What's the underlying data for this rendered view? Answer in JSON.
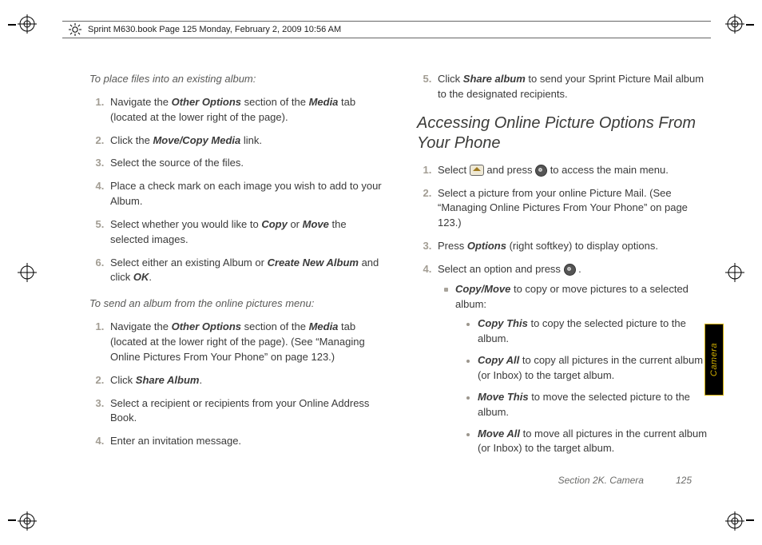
{
  "header": {
    "book_stamp": "Sprint M630.book  Page 125  Monday, February 2, 2009  10:56 AM"
  },
  "left": {
    "h1": "To place files into an existing album:",
    "steps1": [
      {
        "pre": "Navigate the ",
        "b1": "Other Options",
        "mid": " section of the ",
        "b2": "Media",
        "post": " tab (located at the lower right of the page)."
      },
      {
        "pre": "Click the ",
        "b1": "Move/Copy Media",
        "post": " link."
      },
      {
        "plain": "Select the source of the files."
      },
      {
        "plain": "Place a check mark on each image you wish to add to your Album."
      },
      {
        "pre": "Select whether you would like to ",
        "b1": "Copy",
        "mid": " or ",
        "b2": "Move",
        "post": " the selected images."
      },
      {
        "pre": "Select either an existing Album or ",
        "b1": "Create New Album",
        "mid": " and click ",
        "b2": "OK",
        "post": "."
      }
    ],
    "h2": "To send an album from the online pictures menu:",
    "steps2": [
      {
        "pre": "Navigate the ",
        "b1": "Other Options",
        "mid": " section of the ",
        "b2": "Media",
        "post": " tab (located at the lower right of the page). (See “Managing Online Pictures From Your Phone” on page 123.)"
      },
      {
        "pre": "Click ",
        "b1": "Share Album",
        "post": "."
      },
      {
        "plain": "Select a recipient or recipients from your Online Address Book."
      },
      {
        "plain": "Enter an invitation message."
      }
    ]
  },
  "right": {
    "step5": {
      "pre": "Click ",
      "b1": "Share album",
      "post": " to send your Sprint Picture Mail album to the designated recipients."
    },
    "section": "Accessing Online Picture Options From Your Phone",
    "steps": [
      {
        "pre": "Select ",
        "icon1": "home-icon",
        "mid": " and press ",
        "icon2": "menu-ok-icon",
        "post": " to access the main menu."
      },
      {
        "plain": "Select a picture from your online Picture Mail. (See “Managing Online Pictures From Your Phone” on page 123.)"
      },
      {
        "pre": "Press ",
        "b1": "Options",
        "post": " (right softkey) to display options."
      },
      {
        "pre": "Select an option and press ",
        "icon1": "menu-ok-icon",
        "post": " ."
      }
    ],
    "sub": {
      "lead": {
        "b": "Copy/Move",
        "rest": " to copy or move pictures to a selected album:"
      },
      "items": [
        {
          "b": "Copy This",
          "rest": " to copy the selected picture to the album."
        },
        {
          "b": "Copy All",
          "rest": " to copy all pictures in the current album (or Inbox) to the target album."
        },
        {
          "b": "Move This",
          "rest": " to move the selected picture to the album."
        },
        {
          "b": "Move All",
          "rest": " to move all pictures in the current album (or Inbox) to the target album."
        }
      ]
    }
  },
  "sidetab": "Camera",
  "footer": {
    "section": "Section 2K. Camera",
    "page": "125"
  }
}
